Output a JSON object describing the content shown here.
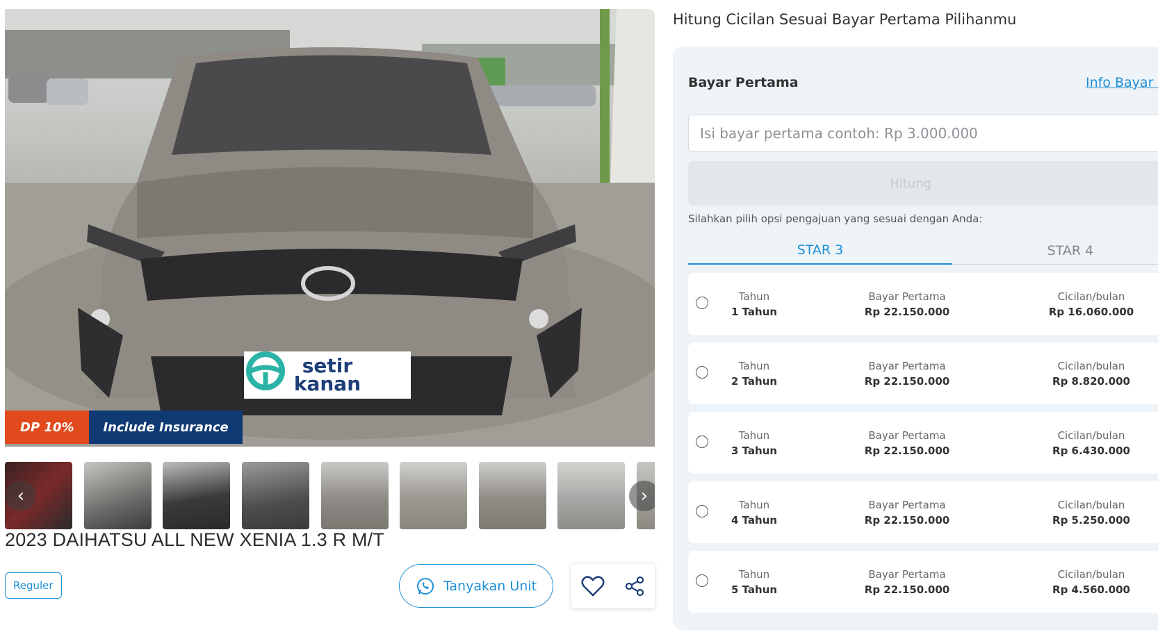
{
  "listing": {
    "title": "2023 DAIHATSU ALL NEW XENIA 1.3 R M/T",
    "tag": "Reguler",
    "badges": {
      "dp": "DP 10%",
      "insurance": "Include Insurance"
    },
    "plate_logo": "setir kanan",
    "ask_button": "Tanyakan Unit",
    "thumbnail_count": 9
  },
  "icons": {
    "ask": "whatsapp-icon",
    "favorite": "heart-icon",
    "share": "share-icon",
    "prev": "chevron-left-icon",
    "next": "chevron-right-icon"
  },
  "calculator": {
    "heading": "Hitung Cicilan Sesuai Bayar Pertama Pilihanmu",
    "first_payment_label": "Bayar Pertama",
    "info_link": "Info Bayar P",
    "input_value": "",
    "input_placeholder": "Isi bayar pertama contoh: Rp 3.000.000",
    "calc_button": "Hitung",
    "hint": "Silahkan pilih opsi pengajuan yang sesuai dengan Anda:",
    "tabs": [
      {
        "label": "STAR 3",
        "active": true
      },
      {
        "label": "STAR 4",
        "active": false
      }
    ],
    "options": [
      {
        "tenor_label": "Tahun",
        "tenor": "1 Tahun",
        "first_label": "Bayar Pertama",
        "first": "Rp 22.150.000",
        "monthly_label": "Cicilan/bulan",
        "monthly": "Rp 16.060.000"
      },
      {
        "tenor_label": "Tahun",
        "tenor": "2 Tahun",
        "first_label": "Bayar Pertama",
        "first": "Rp 22.150.000",
        "monthly_label": "Cicilan/bulan",
        "monthly": "Rp 8.820.000"
      },
      {
        "tenor_label": "Tahun",
        "tenor": "3 Tahun",
        "first_label": "Bayar Pertama",
        "first": "Rp 22.150.000",
        "monthly_label": "Cicilan/bulan",
        "monthly": "Rp 6.430.000"
      },
      {
        "tenor_label": "Tahun",
        "tenor": "4 Tahun",
        "first_label": "Bayar Pertama",
        "first": "Rp 22.150.000",
        "monthly_label": "Cicilan/bulan",
        "monthly": "Rp 5.250.000"
      },
      {
        "tenor_label": "Tahun",
        "tenor": "5 Tahun",
        "first_label": "Bayar Pertama",
        "first": "Rp 22.150.000",
        "monthly_label": "Cicilan/bulan",
        "monthly": "Rp 4.560.000"
      }
    ]
  },
  "colors": {
    "accent": "#1e8fd6",
    "dp_badge": "#e04a1c",
    "insurance_badge": "#103a74",
    "panel_bg": "#eef3f8"
  }
}
